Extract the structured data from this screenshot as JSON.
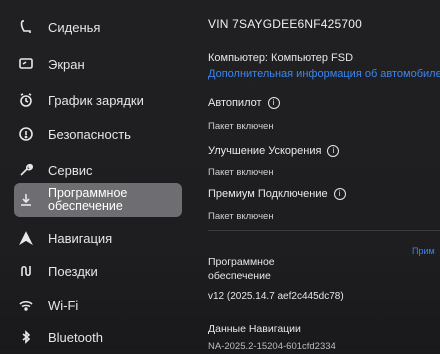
{
  "sidebar": {
    "items": [
      {
        "label": "Сиденья",
        "icon": "seat-icon"
      },
      {
        "label": "Экран",
        "icon": "display-icon"
      },
      {
        "label": "График зарядки",
        "icon": "charging-schedule-icon"
      },
      {
        "label": "Безопасность",
        "icon": "safety-icon"
      },
      {
        "label": "Сервис",
        "icon": "wrench-icon"
      },
      {
        "label": "Программное\nобеспечение",
        "icon": "download-icon",
        "active": true
      },
      {
        "label": "Навигация",
        "icon": "navigation-arrow-icon"
      },
      {
        "label": "Поездки",
        "icon": "trips-icon"
      },
      {
        "label": "Wi-Fi",
        "icon": "wifi-icon"
      },
      {
        "label": "Bluetooth",
        "icon": "bluetooth-icon"
      }
    ]
  },
  "main": {
    "vin": "VIN 7SAYGDEE6NF425700",
    "computer": "Компьютер: Компьютер FSD",
    "more_info_link": "Дополнительная информация об автомобиле",
    "features": [
      {
        "title": "Автопилот",
        "status": "Пакет включен"
      },
      {
        "title": "Улучшение Ускорения",
        "status": "Пакет включен"
      },
      {
        "title": "Премиум Подключение",
        "status": "Пакет включен"
      }
    ],
    "software_title": "Программное обеспечение",
    "software_version": "v12 (2025.14.7 aef2c445dc78)",
    "release_notes_link": "Прим",
    "nav_data_title": "Данные Навигации",
    "nav_data_version": "NA-2025.2-15204-601cfd2334"
  }
}
